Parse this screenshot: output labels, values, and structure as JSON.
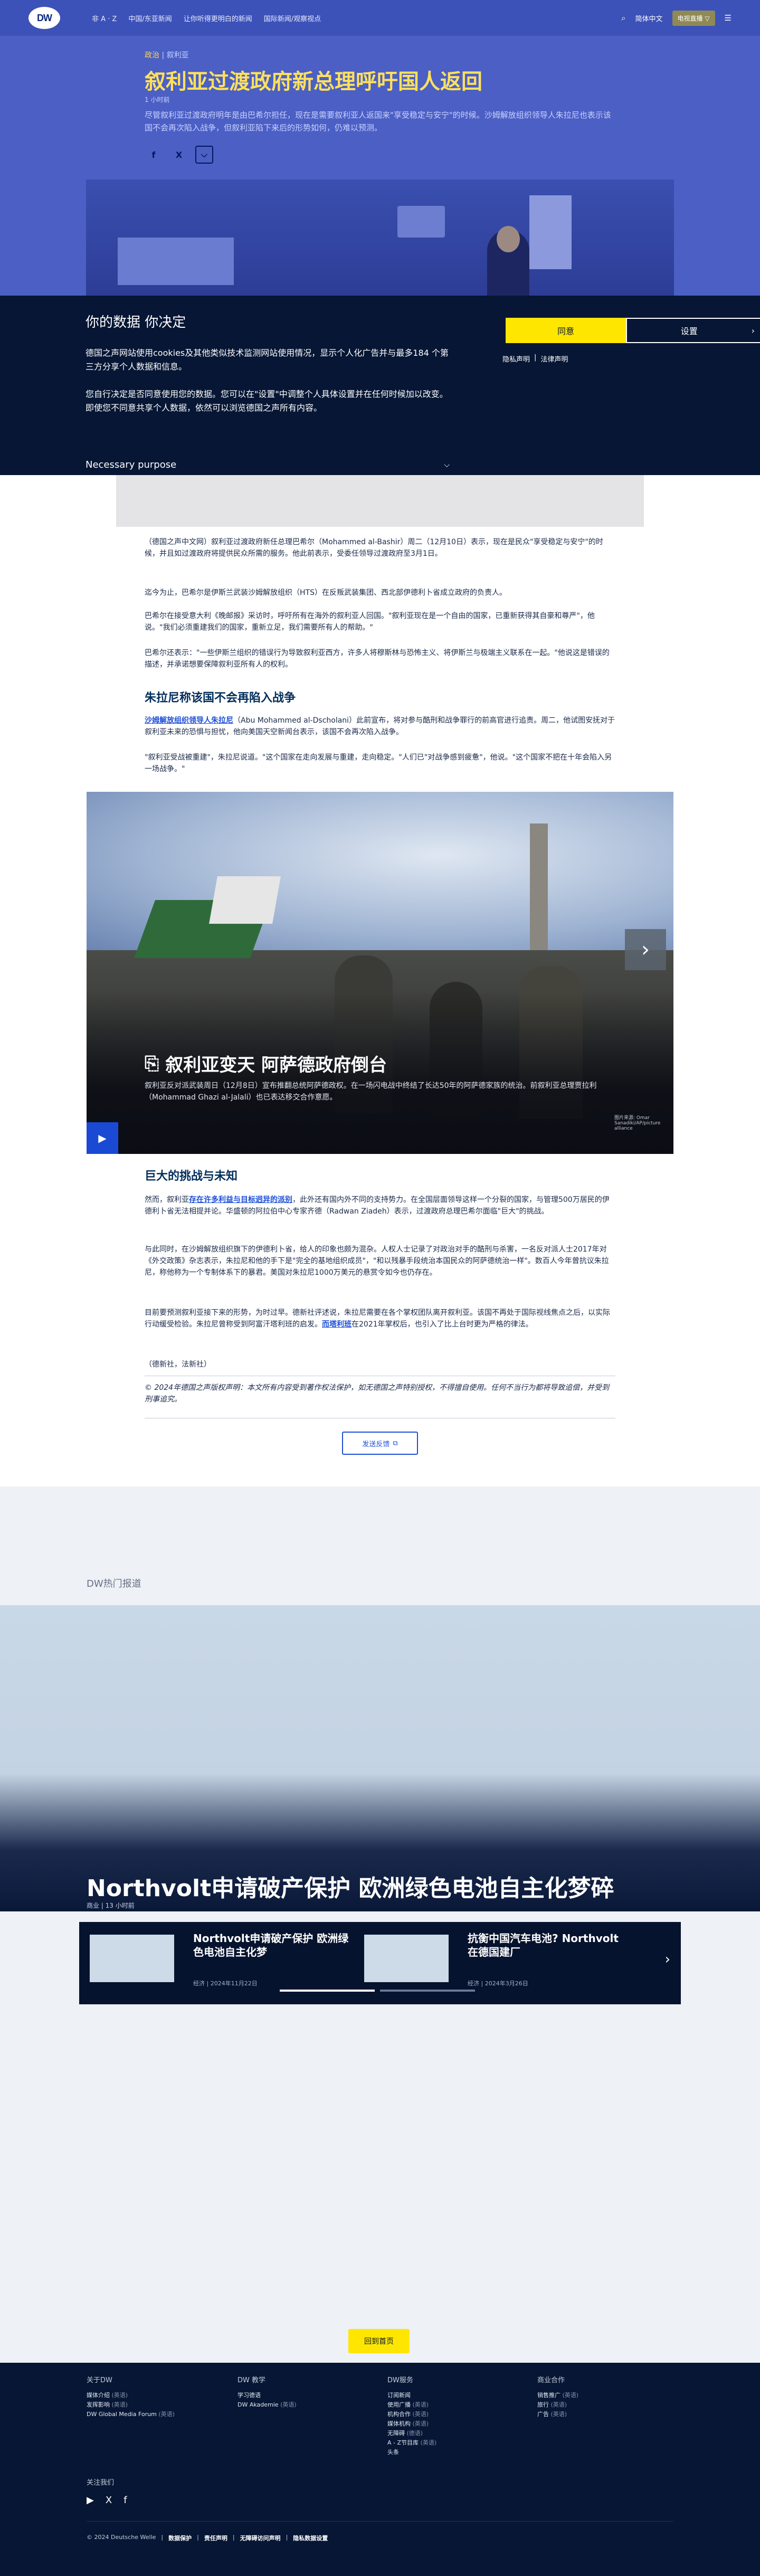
{
  "header": {
    "logo": "DW",
    "nav": [
      "非 A · Z",
      "中国/东亚新闻",
      "让你听得更明白的新闻",
      "国际新闻/观察视点"
    ],
    "right": {
      "search_icon": "search-icon",
      "lang": "简体中文",
      "live": "电视直播 ▽"
    }
  },
  "article": {
    "breadcrumb": {
      "section": "政治",
      "sub": "叙利亚"
    },
    "title": "叙利亚过渡政府新总理呼吁国人返回",
    "time_ago": "1 小时前",
    "lead": "尽管叙利亚过渡政府明年是由巴希尔担任，现在是需要叙利亚人返国来\"享受稳定与安宁\"的时候。沙姆解放组织领导人朱拉尼也表示该国不会再次陷入战争，但叙利亚陷下来后的形势如何，仍难以预测。",
    "share": {
      "facebook": "f",
      "x": "X",
      "more": "⌵"
    },
    "paragraphs": [
      "（德国之声中文网）叙利亚过渡政府新任总理巴希尔（Mohammed al-Bashir）周二（12月10日）表示，现在是民众\"享受稳定与安宁\"的时候，并且如过渡政府将提供民众所需的服务。他此前表示，受委任领导过渡政府至3月1日。",
      "迄今为止，巴希尔是伊斯兰武装沙姆解放组织（HTS）在反叛武装集团、西北部伊德利卜省成立政府的负责人。",
      "巴希尔在接受意大利《晚邮报》采访时，呼吁所有在海外的叙利亚人回国。\"叙利亚现在是一个自由的国家，已重新获得其自豪和尊严\"，他说。\"我们必须重建我们的国家，重新立足，我们需要所有人的帮助。\"",
      "巴希尔还表示：\"一些伊斯兰组织的错误行为导致叙利亚西方，许多人将穆斯林与恐怖主义、将伊斯兰与极端主义联系在一起。\"他说这是错误的描述，并承诺想要保障叙利亚所有人的权利。"
    ],
    "h_not_war": "朱拉尼称该国不会再陷入战争",
    "jolani_link": "沙姆解放组织领导人朱拉尼",
    "jolani_rest": "（Abu Mohammed al-Dscholani）此前宣布，将对参与酷刑和战争罪行的前高官进行追责。周二，他试图安抚对于叙利亚未来的恐惧与担忧，他向美国天空新闻台表示，该国不会再次陷入战争。",
    "jolani_quote": "\"叙利亚受战被重建\"，朱拉尼说道。\"这个国家在走向发展与重建，走向稳定。\"人们已\"对战争感到疲惫\"，他说。\"这个国家不把在十年会陷入另一场战争。\"",
    "gallery": {
      "title": "叙利亚变天 阿萨德政府倒台",
      "desc": "叙利亚反对派武装周日（12月8日）宣布推翻总统阿萨德政权。在一场闪电战中终结了长达50年的阿萨德家族的统治。前叙利亚总理贾拉利（Mohammad Ghazi al-Jalali）也已表达移交合作意愿。",
      "credit": "图片来源: Omar Sanadiki/AP/picture alliance"
    },
    "h_challenges": "巨大的挑战与未知",
    "challenges_prefix": "然而，叙利亚",
    "challenges_link": "存在许多利益与目标迥异的派别",
    "challenges_rest": "，此外还有国内外不同的支持势力。在全国层面领导这样一个分裂的国家，与管理500万居民的伊德利卜省无法相提并论。华盛顿的阿拉伯中心专家齐德（Radwan Ziadeh）表示，过渡政府总理巴希尔面临\"巨大\"的挑战。",
    "para_hts": "与此同时，在沙姆解放组织旗下的伊德利卜省，给人的印象也颇为混杂。人权人士记录了对政治对手的酷刑与杀害，一名反对派人士2017年对《外交政策》杂志表示，朱拉尼和他的手下是\"完全的基地组织成员\"，\"和以残暴手段统治本国民众的阿萨德统治一样\"。数百人今年曾抗议朱拉尼，称他称为一个专制体系下的暴君。美国对朱拉尼1000万美元的悬赏令如今也仍存在。",
    "para_target_prefix": "目前要预测叙利亚接下来的形势，为时过早。德新社评述说，朱拉尼需要在各个掌权团队离开叙利亚。该国不再处于国际视线焦点之后，以实际行动缓受检验。朱拉尼曾称受到阿富汗塔利班的启发。",
    "para_target_link": "而塔利班",
    "para_target_rest": "在2021年掌权后，也引入了比上台时更为严格的律法。",
    "sources": "（德新社，法新社）",
    "copyright": "© 2024年德国之声版权声明：本文所有内容受到著作权法保护，如无德国之声特别授权，不得擅自使用。任何不当行为都将导致追偿，并受到刑事追究。",
    "feedback": "发送反馈"
  },
  "consent": {
    "title": "你的数据 你决定",
    "p1": "德国之声网站使用cookies及其他类似技术监测网站使用情况，显示个人化广告并与最多184 个第三方分享个人数据和信息。",
    "p2": "您自行决定是否同意使用您的数据。您可以在\"设置\"中调整个人具体设置并在任何时候加以改变。即使您不同意共享个人数据，依然可以浏览德国之声所有内容。",
    "accept": "同意",
    "settings": "设置",
    "privacy": "隐私声明",
    "legal": "法律声明",
    "necessary": "Necessary purpose"
  },
  "top_stories": {
    "label": "DW热门报道",
    "hero_title": "Northvolt申请破产保护 欧洲绿色电池自主化梦碎",
    "hero_meta": "商业 | 13 小时前",
    "cards": [
      {
        "title": "Northvolt申请破产保护 欧洲绿色电池自主化梦",
        "meta": "经济 | 2024年11月22日"
      },
      {
        "title": "抗衡中国汽车电池? Northvolt在德国建厂",
        "meta": "经济 | 2024年3月26日"
      }
    ]
  },
  "home_button": "回到首页",
  "footer": {
    "cols": [
      {
        "title": "关于DW",
        "items": [
          [
            "媒体介绍",
            "(英语)"
          ],
          [
            "发挥影响",
            "(英语)"
          ],
          [
            "DW Global Media Forum",
            "(英语)"
          ]
        ]
      },
      {
        "title": "DW 教学",
        "items": [
          [
            "学习德语",
            ""
          ],
          [
            "DW Akademie",
            "(英语)"
          ]
        ]
      },
      {
        "title": "DW服务",
        "items": [
          [
            "订阅新闻",
            ""
          ],
          [
            "使用广播",
            "(英语)"
          ],
          [
            "机构合作",
            "(英语)"
          ],
          [
            "媒体机构",
            "(英语)"
          ],
          [
            "无障碍",
            "(德语)"
          ],
          [
            "A - Z节目库",
            "(英语)"
          ],
          [
            "头条",
            ""
          ]
        ]
      },
      {
        "title": "商业合作",
        "items": [
          [
            "销售推广",
            "(英语)"
          ],
          [
            "旅行",
            "(英语)"
          ],
          [
            "广告",
            "(英语)"
          ]
        ]
      }
    ],
    "follow": "关注我们",
    "legal": [
      "© 2024 Deutsche Welle",
      "数据保护",
      "责任声明",
      "无障碍访问声明",
      "隐私数据设置"
    ]
  }
}
